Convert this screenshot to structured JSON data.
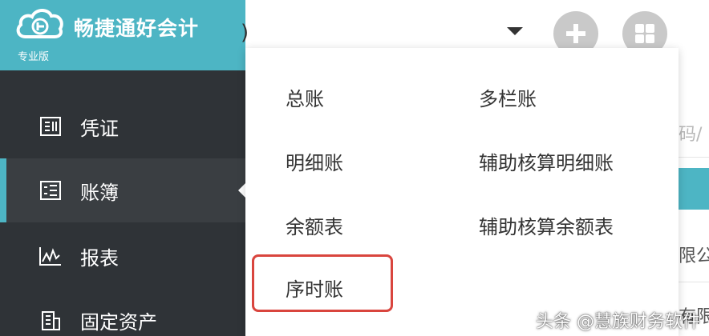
{
  "brand": {
    "name": "畅捷通好会计",
    "edition": "专业版",
    "color": "#4db5c4"
  },
  "sidebar": {
    "items": [
      {
        "label": "凭证",
        "icon": "voucher-icon"
      },
      {
        "label": "账簿",
        "icon": "ledger-icon",
        "active": true
      },
      {
        "label": "报表",
        "icon": "report-chart-icon"
      },
      {
        "label": "固定资产",
        "icon": "building-icon"
      }
    ]
  },
  "topbar": {
    "add_icon": "plus-icon",
    "apps_icon": "grid-icon",
    "caret_icon": "caret-down-icon",
    "partial_text": ")"
  },
  "ledger_menu": {
    "col1": [
      "总账",
      "明细账",
      "余额表",
      "序时账"
    ],
    "col2": [
      "多栏账",
      "辅助核算明细账",
      "辅助核算余额表"
    ],
    "highlighted": "序时账",
    "highlight_color": "#d9453e"
  },
  "background_fragments": {
    "search_placeholder": "码/",
    "row1": "限公",
    "row2": "有限"
  },
  "watermark": "头条 @慧族财务软件"
}
